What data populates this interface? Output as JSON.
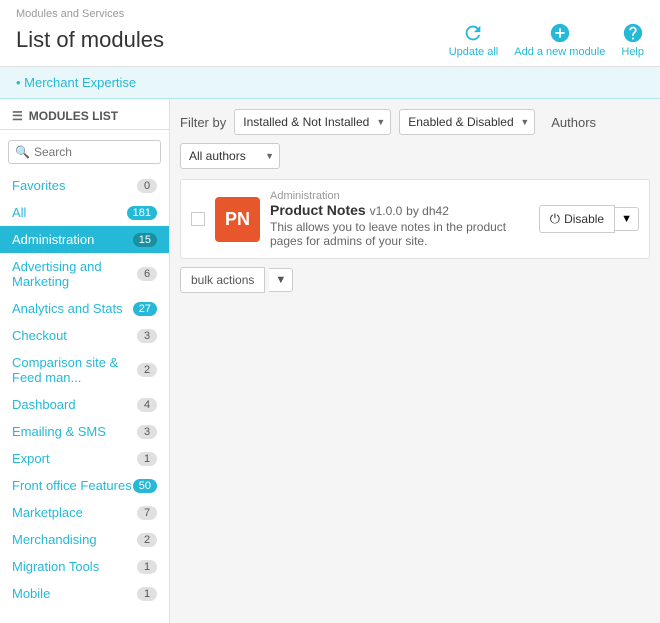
{
  "header": {
    "breadcrumb": "Modules and Services",
    "title": "List of modules",
    "actions": [
      {
        "id": "update-all",
        "label": "Update all",
        "icon": "refresh-icon"
      },
      {
        "id": "add-module",
        "label": "Add a new module",
        "icon": "plus-icon"
      },
      {
        "id": "help",
        "label": "Help",
        "icon": "help-icon"
      }
    ]
  },
  "merchant_bar": {
    "text": "Merchant Expertise"
  },
  "sidebar": {
    "header": "MODULES LIST",
    "search_placeholder": "Search",
    "items": [
      {
        "id": "favorites",
        "label": "Favorites",
        "count": "0",
        "active": false
      },
      {
        "id": "all",
        "label": "All",
        "count": "181",
        "active": false
      },
      {
        "id": "administration",
        "label": "Administration",
        "count": "15",
        "active": true
      },
      {
        "id": "advertising",
        "label": "Advertising and Marketing",
        "count": "6",
        "active": false
      },
      {
        "id": "analytics",
        "label": "Analytics and Stats",
        "count": "27",
        "active": false
      },
      {
        "id": "checkout",
        "label": "Checkout",
        "count": "3",
        "active": false
      },
      {
        "id": "comparison",
        "label": "Comparison site & Feed man...",
        "count": "2",
        "active": false
      },
      {
        "id": "dashboard",
        "label": "Dashboard",
        "count": "4",
        "active": false
      },
      {
        "id": "emailing",
        "label": "Emailing & SMS",
        "count": "3",
        "active": false
      },
      {
        "id": "export",
        "label": "Export",
        "count": "1",
        "active": false
      },
      {
        "id": "front-office",
        "label": "Front office Features",
        "count": "50",
        "active": false
      },
      {
        "id": "marketplace",
        "label": "Marketplace",
        "count": "7",
        "active": false
      },
      {
        "id": "merchandising",
        "label": "Merchandising",
        "count": "2",
        "active": false
      },
      {
        "id": "migration",
        "label": "Migration Tools",
        "count": "1",
        "active": false
      },
      {
        "id": "mobile",
        "label": "Mobile",
        "count": "1",
        "active": false
      }
    ]
  },
  "filters": {
    "filter_by_label": "Filter by",
    "install_filter": "Installed & Not Installed",
    "status_filter": "Enabled & Disabled",
    "authors_label": "Authors",
    "authors_value": "All authors"
  },
  "module": {
    "category": "Administration",
    "name": "Product Notes",
    "version": "v1.0.0",
    "author": "by dh42",
    "description": "This allows you to leave notes in the product pages for admins of your site.",
    "action_label": "Disable",
    "logo_initials": "PN"
  },
  "bulk": {
    "label": "bulk actions"
  }
}
